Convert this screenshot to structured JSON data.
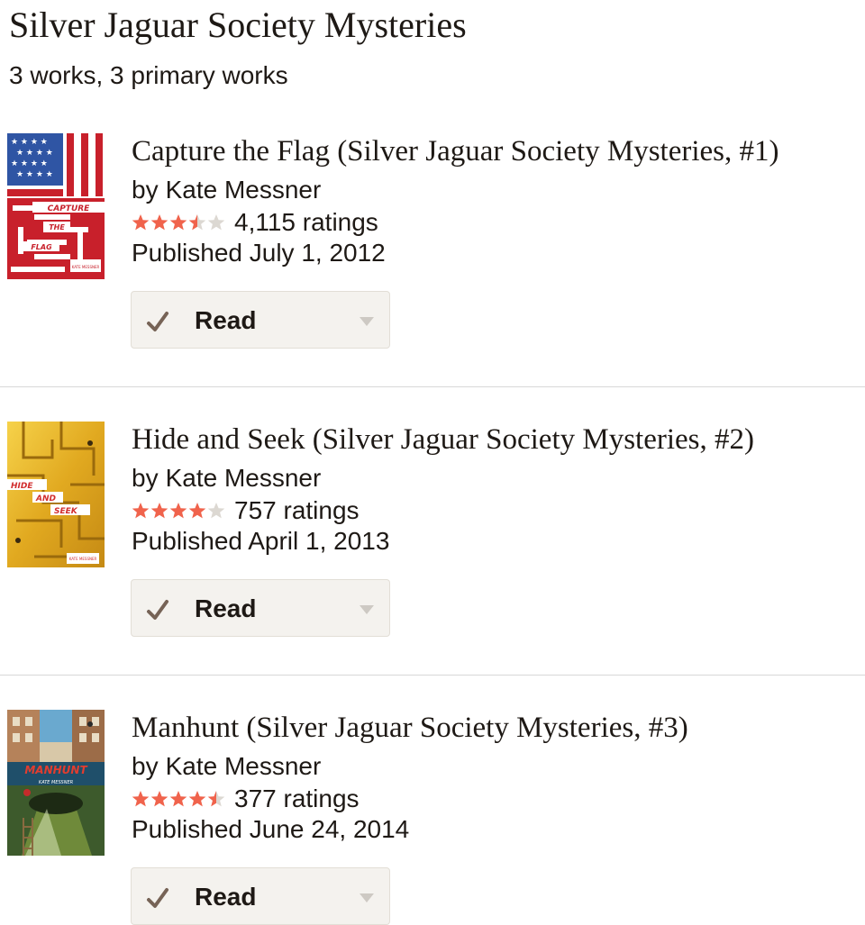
{
  "series": {
    "title": "Silver Jaguar Society Mysteries",
    "count_text": "3 works, 3 primary works"
  },
  "colors": {
    "star_filled": "#f0634c",
    "star_empty": "#dcd8d2",
    "check": "#766356",
    "button_bg": "#f4f2ee"
  },
  "books": [
    {
      "title": "Capture the Flag (Silver Jaguar Society Mysteries, #1)",
      "by_label": "by",
      "author": "Kate Messner",
      "rating": 3.5,
      "ratings_text": "4,115 ratings",
      "published": "Published July 1, 2012",
      "shelf_label": "Read",
      "cover_text": {
        "line1": "CAPTURE",
        "line2": "THE",
        "line3": "FLAG",
        "author": "KATE MESSNER"
      }
    },
    {
      "title": "Hide and Seek (Silver Jaguar Society Mysteries, #2)",
      "by_label": "by",
      "author": "Kate Messner",
      "rating": 4,
      "ratings_text": "757 ratings",
      "published": "Published April 1, 2013",
      "shelf_label": "Read",
      "cover_text": {
        "line1": "HIDE",
        "line2": "AND",
        "line3": "SEEK",
        "author": "KATE MESSNER"
      }
    },
    {
      "title": "Manhunt (Silver Jaguar Society Mysteries, #3)",
      "by_label": "by",
      "author": "Kate Messner",
      "rating": 4.5,
      "ratings_text": "377 ratings",
      "published": "Published June 24, 2014",
      "shelf_label": "Read",
      "cover_text": {
        "line1": "MANHUNT",
        "author": "KATE MESSNER"
      }
    }
  ]
}
